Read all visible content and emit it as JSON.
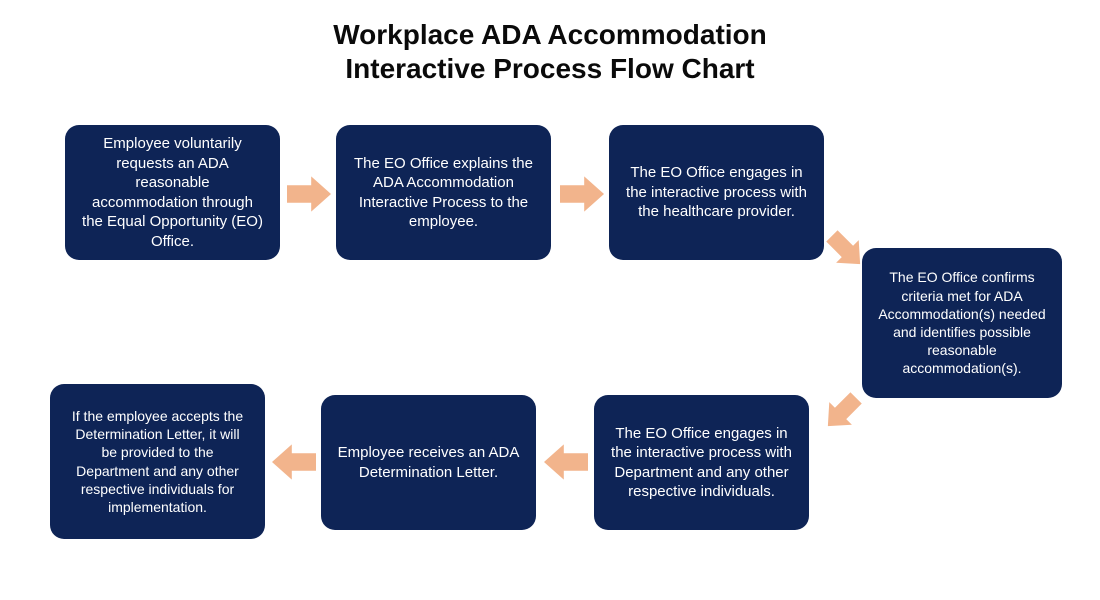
{
  "title_line1": "Workplace ADA Accommodation",
  "title_line2": "Interactive Process Flow Chart",
  "boxes": {
    "b1": "Employee voluntarily requests an ADA reasonable accommodation through the Equal Opportunity (EO) Office.",
    "b2": "The EO Office explains the ADA Accommodation Interactive Process to the employee.",
    "b3": "The EO Office engages in the interactive process with the healthcare provider.",
    "b4": "The EO Office confirms criteria met for ADA Accommodation(s) needed and identifies possible reasonable accommodation(s).",
    "b5": "The EO Office engages in the interactive process with Department and any other respective individuals.",
    "b6": "Employee receives an ADA Determination Letter.",
    "b7": "If the employee accepts the Determination Letter, it will be provided to the Department and any other respective individuals for implementation."
  },
  "colors": {
    "box_bg": "#0e2456",
    "box_text": "#ffffff",
    "arrow_fill": "#f2b48c"
  }
}
